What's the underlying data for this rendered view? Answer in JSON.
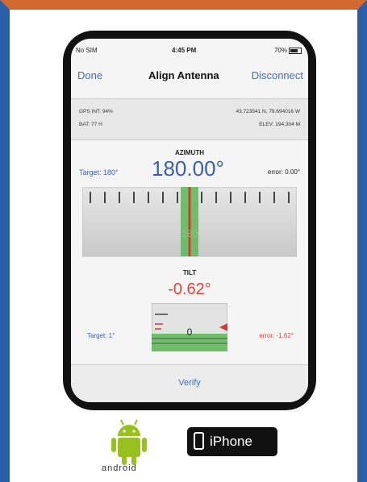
{
  "status_bar": {
    "carrier": "No SIM",
    "time": "4:45 PM",
    "battery": "70%"
  },
  "nav": {
    "done": "Done",
    "title": "Align Antenna",
    "disconnect": "Disconnect"
  },
  "gps": {
    "gps_int": "GPS INT: 94%",
    "bat": "BAT: 77 H",
    "coords": "43.723541 N, 79.694016 W",
    "elev": "ELEV: 194.304 M"
  },
  "azimuth": {
    "title": "AZIMUTH",
    "target": "Target: 180°",
    "value": "180.00°",
    "error": "error: 0.00°",
    "scale_label": "180"
  },
  "tilt": {
    "title": "TILT",
    "value": "-0.62°",
    "target": "Target: 1°",
    "error": "error: -1.62°",
    "gauge_label": "0"
  },
  "verify": "Verify",
  "platforms": {
    "android": "android",
    "iphone": "iPhone"
  },
  "colors": {
    "accent": "#3b6fc4",
    "error": "#e24335",
    "green": "#4caf50",
    "android_green": "#97c11f"
  },
  "icons": [
    "battery-icon",
    "android-robot-icon",
    "iphone-icon"
  ]
}
